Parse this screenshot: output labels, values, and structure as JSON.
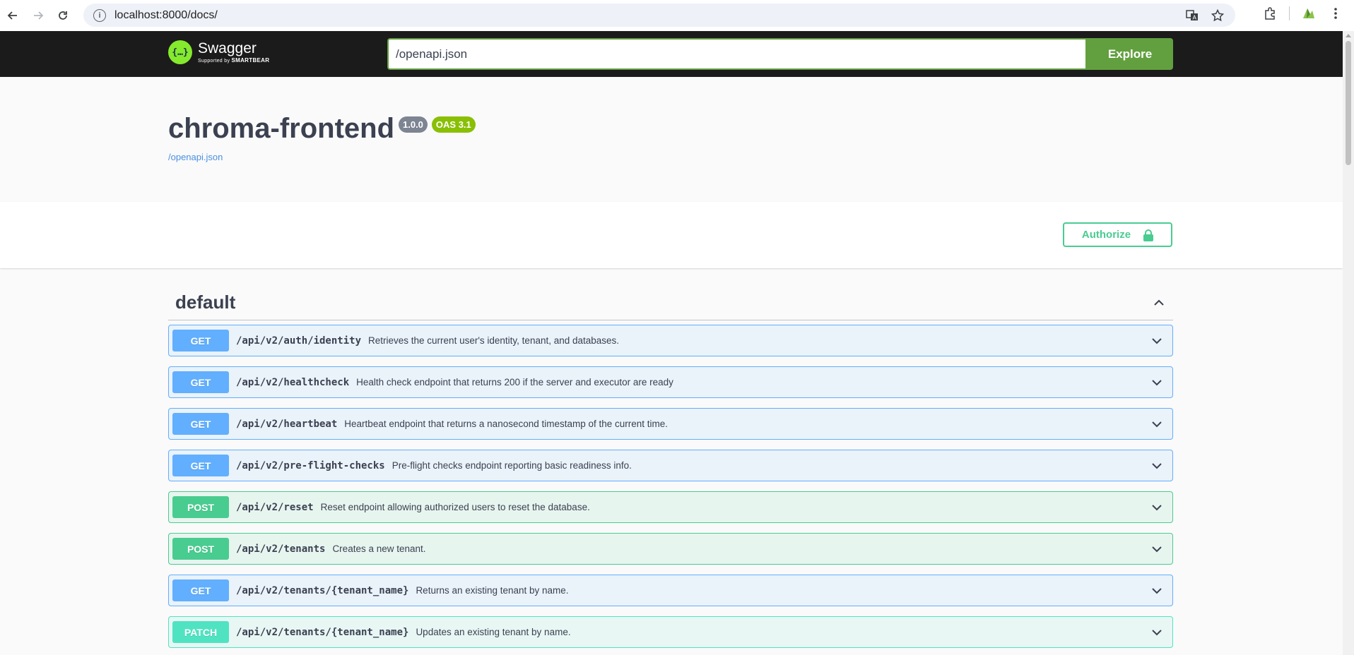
{
  "browser": {
    "url": "localhost:8000/docs/"
  },
  "topbar": {
    "logo_title": "Swagger",
    "logo_sub_prefix": "Supported by ",
    "logo_sub_brand": "SMARTBEAR",
    "spec_url": "/openapi.json",
    "explore_label": "Explore"
  },
  "info": {
    "title": "chroma-frontend",
    "version": "1.0.0",
    "oas": "OAS 3.1",
    "spec_link": "/openapi.json"
  },
  "authorize_label": "Authorize",
  "tag": {
    "name": "default"
  },
  "operations": [
    {
      "method": "GET",
      "path": "/api/v2/auth/identity",
      "summary": "Retrieves the current user's identity, tenant, and databases."
    },
    {
      "method": "GET",
      "path": "/api/v2/healthcheck",
      "summary": "Health check endpoint that returns 200 if the server and executor are ready"
    },
    {
      "method": "GET",
      "path": "/api/v2/heartbeat",
      "summary": "Heartbeat endpoint that returns a nanosecond timestamp of the current time."
    },
    {
      "method": "GET",
      "path": "/api/v2/pre-flight-checks",
      "summary": "Pre-flight checks endpoint reporting basic readiness info."
    },
    {
      "method": "POST",
      "path": "/api/v2/reset",
      "summary": "Reset endpoint allowing authorized users to reset the database."
    },
    {
      "method": "POST",
      "path": "/api/v2/tenants",
      "summary": "Creates a new tenant."
    },
    {
      "method": "GET",
      "path": "/api/v2/tenants/{tenant_name}",
      "summary": "Returns an existing tenant by name."
    },
    {
      "method": "PATCH",
      "path": "/api/v2/tenants/{tenant_name}",
      "summary": "Updates an existing tenant by name."
    }
  ],
  "colors": {
    "get": "#61affe",
    "post": "#49cc90",
    "patch": "#50e3c2",
    "explore": "#62a03f",
    "topbar": "#1b1b1b"
  }
}
